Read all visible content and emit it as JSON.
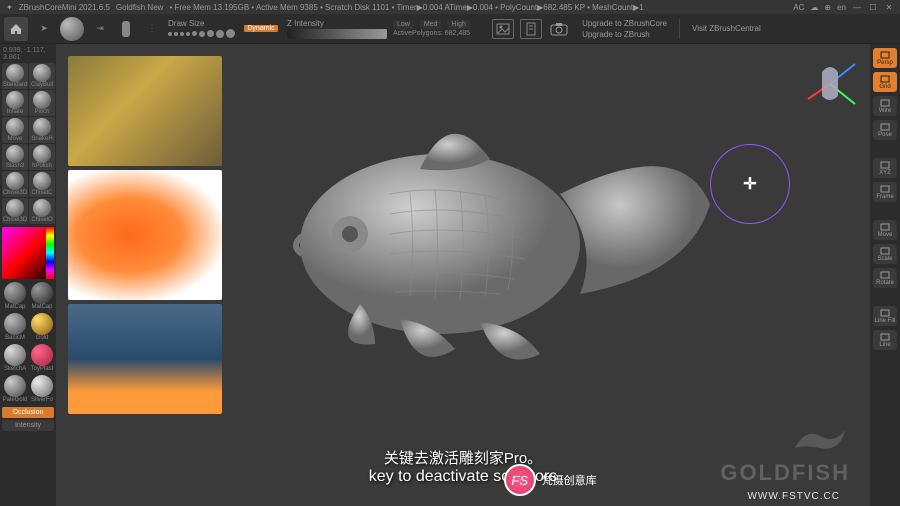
{
  "app": {
    "name": "ZBrushCoreMini 2021.6.5",
    "project": "Goldfish New",
    "stats": "• Free Mem 13.195GB • Active Mem 9385 • Scratch Disk 1101 • Timer▶0.004 ATime▶0.004 • PolyCount▶682.485 KP • MeshCount▶1"
  },
  "titlebar_right": {
    "ac": "AC",
    "lang": "en"
  },
  "coord": "0.939, -1.117, 3.861",
  "topbar": {
    "draw_size": "Draw Size",
    "z_intensity": "Z Intensity",
    "dynamic_label": "Dynamic",
    "levels": {
      "low": "Low",
      "med": "Med",
      "high": "High"
    },
    "active_polys_label": "ActivePolygons:",
    "active_polys_value": "682,485",
    "upgrade_core": "Upgrade to ZBrushCore",
    "upgrade_zbrush": "Upgrade to ZBrush",
    "visit": "Visit ZBrushCentral"
  },
  "brushes": [
    {
      "name": "Standard"
    },
    {
      "name": "ClayBuil"
    },
    {
      "name": "Inflate"
    },
    {
      "name": "Pinch"
    },
    {
      "name": "Move"
    },
    {
      "name": "SnakeH"
    },
    {
      "name": "Slash3"
    },
    {
      "name": "hPolish"
    },
    {
      "name": "Chisel3D"
    },
    {
      "name": "ChiselC"
    },
    {
      "name": "Chisel3D"
    },
    {
      "name": "ChiselO"
    }
  ],
  "materials": [
    {
      "name": "MatCap",
      "bg": "radial-gradient(circle at 30% 30%,#aaa,#333)"
    },
    {
      "name": "MatCap",
      "bg": "radial-gradient(circle at 30% 30%,#999,#222)"
    },
    {
      "name": "BasicM",
      "bg": "radial-gradient(circle at 30% 30%,#bbb,#444)"
    },
    {
      "name": "Gold",
      "bg": "radial-gradient(circle at 30% 30%,#ffdd66,#885511)"
    },
    {
      "name": "SketchA",
      "bg": "radial-gradient(circle at 30% 30%,#ddd,#555)"
    },
    {
      "name": "ToyPlast",
      "bg": "radial-gradient(circle at 30% 30%,#ff6688,#aa2244)"
    },
    {
      "name": "PaleGold",
      "bg": "radial-gradient(circle at 30% 30%,#ccc,#444)"
    },
    {
      "name": "SilverFo",
      "bg": "radial-gradient(circle at 30% 30%,#eee,#666)"
    }
  ],
  "side_buttons": {
    "occlusion": "Occlusion",
    "intensity": "Intensity"
  },
  "right_panel": [
    {
      "label": "Persp",
      "cls": "orange"
    },
    {
      "label": "Grid",
      "cls": "orange"
    },
    {
      "label": "Wire",
      "cls": "dark"
    },
    {
      "label": "Pose",
      "cls": "dark"
    },
    {
      "label": "",
      "cls": "spacer"
    },
    {
      "label": "XYZ",
      "cls": "dark"
    },
    {
      "label": "Frame",
      "cls": "dark"
    },
    {
      "label": "",
      "cls": "spacer"
    },
    {
      "label": "Move",
      "cls": "dark"
    },
    {
      "label": "Scale",
      "cls": "dark"
    },
    {
      "label": "Rotate",
      "cls": "dark"
    },
    {
      "label": "",
      "cls": "spacer"
    },
    {
      "label": "Line Fill",
      "cls": "dark"
    },
    {
      "label": "Line",
      "cls": "dark"
    }
  ],
  "logo_text": "GOLDFISH",
  "subtitles": {
    "cn": "关键去激活雕刻家Pro。",
    "en": "key to deactivate sculptors"
  },
  "watermark": {
    "brand": "FS",
    "text": "梵摄创意库",
    "url": "WWW.FSTVC.CC"
  }
}
